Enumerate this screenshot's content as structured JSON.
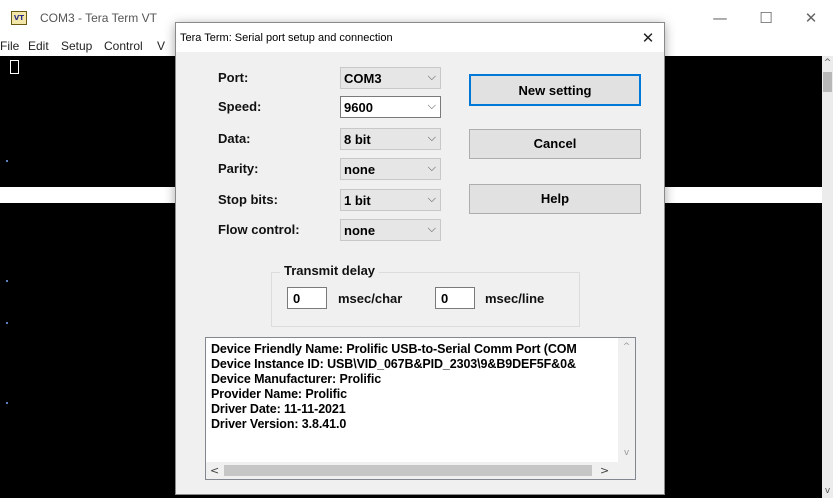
{
  "main_window": {
    "icon_text": "VT",
    "title": "COM3 - Tera Term VT",
    "minimize_glyph": "—",
    "maximize_glyph": "☐",
    "close_glyph": "✕",
    "menu": [
      "File",
      "Edit",
      "Setup",
      "Control",
      "V"
    ],
    "scroll_up_glyph": "^",
    "scroll_down_glyph": "v"
  },
  "dialog": {
    "title": "Tera Term: Serial port setup and connection",
    "close_glyph": "✕",
    "fields": [
      {
        "label": "Port:",
        "value": "COM3",
        "editable": false
      },
      {
        "label": "Speed:",
        "value": "9600",
        "editable": true
      },
      {
        "label": "Data:",
        "value": "8 bit",
        "editable": false
      },
      {
        "label": "Parity:",
        "value": "none",
        "editable": false
      },
      {
        "label": "Stop bits:",
        "value": "1 bit",
        "editable": false
      },
      {
        "label": "Flow control:",
        "value": "none",
        "editable": false
      }
    ],
    "dropdown_glyph": "⌵",
    "buttons": {
      "new_setting": "New setting",
      "cancel": "Cancel",
      "help": "Help"
    },
    "transmit_delay": {
      "legend": "Transmit delay",
      "char_value": "0",
      "char_unit": "msec/char",
      "line_value": "0",
      "line_unit": "msec/line"
    },
    "device_info": [
      "Device Friendly Name: Prolific USB-to-Serial Comm Port (COM",
      "Device Instance ID: USB\\VID_067B&PID_2303\\9&B9DEF5F&0&",
      "Device Manufacturer: Prolific",
      "Provider Name: Prolific",
      "Driver Date: 11-11-2021",
      "Driver Version: 3.8.41.0"
    ],
    "scroll_glyphs": {
      "up": "^",
      "down": "v",
      "left": "<",
      "right": ">"
    }
  },
  "colors": {
    "terminal_bg": "#000000",
    "dialog_bg": "#f0f0f0",
    "default_button_border": "#0078d7"
  }
}
